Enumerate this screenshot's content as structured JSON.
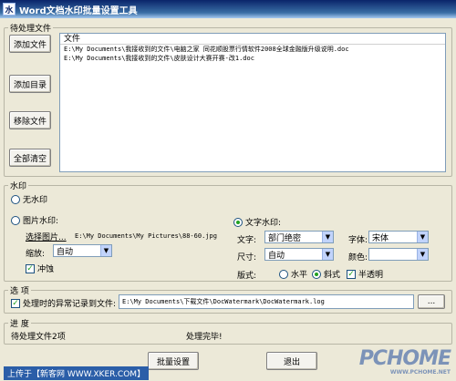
{
  "window": {
    "title": "Word文档水印批量设置工具",
    "icon_text": "水"
  },
  "pending": {
    "legend": "待处理文件",
    "buttons": [
      "添加文件",
      "添加目录",
      "移除文件",
      "全部清空"
    ],
    "list_header": "文件",
    "files": [
      "E:\\My Documents\\我接收到的文件\\电脑之家 同花顺股票行情软件2008全球金融版升级说明.doc",
      "E:\\My Documents\\我接收到的文件\\皮肤设计大赛开赛-改1.doc"
    ]
  },
  "watermark": {
    "legend": "水印",
    "none_label": "无水印",
    "image_label": "图片水印:",
    "select_image_link": "选择图片...",
    "image_path": "E:\\My Documents\\My Pictures\\88-60.jpg",
    "scale_label": "缩放:",
    "scale_value": "自动",
    "washout_label": "冲蚀",
    "text_label": "文字水印:",
    "text_field_label": "文字:",
    "text_value": "部门绝密",
    "font_label": "字体:",
    "font_value": "宋体",
    "size_label": "尺寸:",
    "size_value": "自动",
    "color_label": "颜色:",
    "layout_label": "版式:",
    "horizontal_label": "水平",
    "diagonal_label": "斜式",
    "semi_transparent_label": "半透明"
  },
  "options": {
    "legend": "选  项",
    "record_label": "处理时的异常记录到文件:",
    "record_path": "E:\\My Documents\\下载文件\\DocWatermark\\DocWatermark.log",
    "browse_label": "..."
  },
  "progress": {
    "legend": "进 度",
    "pending_count": "待处理文件2项",
    "status": "处理完毕!"
  },
  "actions": {
    "batch_label": "批量设置",
    "exit_label": "退出"
  },
  "overlay": {
    "brand": "PCHOME",
    "site": "WWW.PCHOME.NET",
    "upload_banner": "上传于【新客网 WWW.XKER.COM】"
  },
  "colors": {
    "titlebar": "#0a246a",
    "window_bg": "#ece9d8",
    "accent": "#21a121"
  }
}
